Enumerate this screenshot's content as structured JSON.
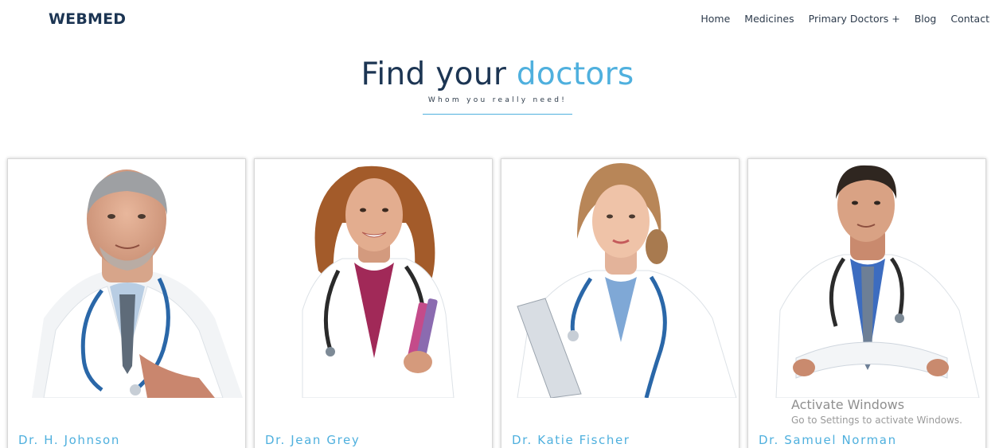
{
  "header": {
    "brand": "WEBMED",
    "nav": [
      "Home",
      "Medicines",
      "Primary Doctors +",
      "Blog",
      "Contact"
    ]
  },
  "hero": {
    "title_main": "Find your",
    "title_accent": "doctors",
    "subtitle": "Whom you really need!"
  },
  "doctors": [
    {
      "name": "Dr. H. Johnson"
    },
    {
      "name": "Dr. Jean Grey"
    },
    {
      "name": "Dr. Katie Fischer"
    },
    {
      "name": "Dr. Samuel Norman"
    }
  ],
  "watermark": {
    "title": "Activate Windows",
    "subtitle": "Go to Settings to activate Windows."
  },
  "colors": {
    "brand": "#1c3553",
    "accent": "#4fb0de",
    "text": "#2d3b4c"
  }
}
